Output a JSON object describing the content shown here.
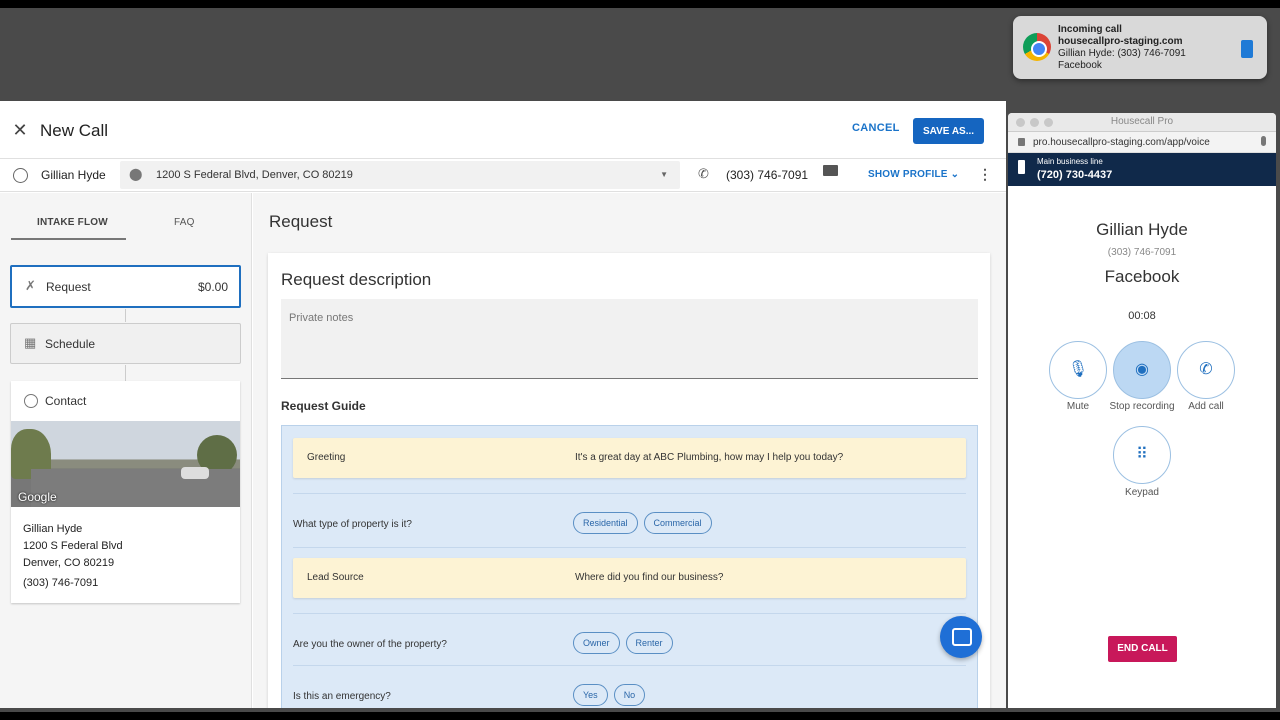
{
  "notification": {
    "title": "Incoming call",
    "domain": "housecallpro-staging.com",
    "caller": "Gillian Hyde: (303) 746-7091",
    "source": "Facebook"
  },
  "header": {
    "title": "New Call",
    "cancel_label": "CANCEL",
    "save_label": "SAVE AS..."
  },
  "customer_bar": {
    "name": "Gillian Hyde",
    "address": "1200 S Federal Blvd, Denver, CO 80219",
    "phone": "(303) 746-7091",
    "show_profile_label": "SHOW PROFILE"
  },
  "sidebar": {
    "tabs": [
      {
        "label": "INTAKE FLOW"
      },
      {
        "label": "FAQ"
      }
    ],
    "steps": [
      {
        "label": "Request",
        "price": "$0.00"
      },
      {
        "label": "Schedule"
      }
    ],
    "contact": {
      "label": "Contact",
      "map_logo": "Google",
      "name": "Gillian Hyde",
      "street": "1200 S Federal Blvd",
      "city": "Denver, CO 80219",
      "phone": "(303) 746-7091"
    }
  },
  "main": {
    "title": "Request",
    "card_title": "Request description",
    "notes_placeholder": "Private notes",
    "guide_title": "Request Guide",
    "guide": [
      {
        "question": "Greeting",
        "answer": "It's a great day at ABC Plumbing, how may I help you today?"
      },
      {
        "question": "What type of property is it?",
        "options": [
          "Residential",
          "Commercial"
        ]
      },
      {
        "question": "Lead Source",
        "answer": "Where did you find our business?"
      },
      {
        "question": "Are you the owner of the property?",
        "options": [
          "Owner",
          "Renter"
        ]
      },
      {
        "question": "Is this an emergency?",
        "options": [
          "Yes",
          "No"
        ]
      }
    ]
  },
  "voice": {
    "window_title": "Housecall Pro",
    "url": "pro.housecallpro-staging.com/app/voice",
    "line_label": "Main business line",
    "line_number": "(720) 730-4437",
    "caller_name": "Gillian Hyde",
    "caller_number": "(303) 746-7091",
    "caller_source": "Facebook",
    "timer": "00:08",
    "buttons": {
      "mute": "Mute",
      "stop_recording": "Stop recording",
      "add_call": "Add call",
      "keypad": "Keypad"
    },
    "end_call": "END CALL"
  },
  "colors": {
    "primary": "#1565c0",
    "end_call": "#c8185a",
    "voice_bar": "#10294a",
    "guide_highlight": "#fdf3d4"
  }
}
